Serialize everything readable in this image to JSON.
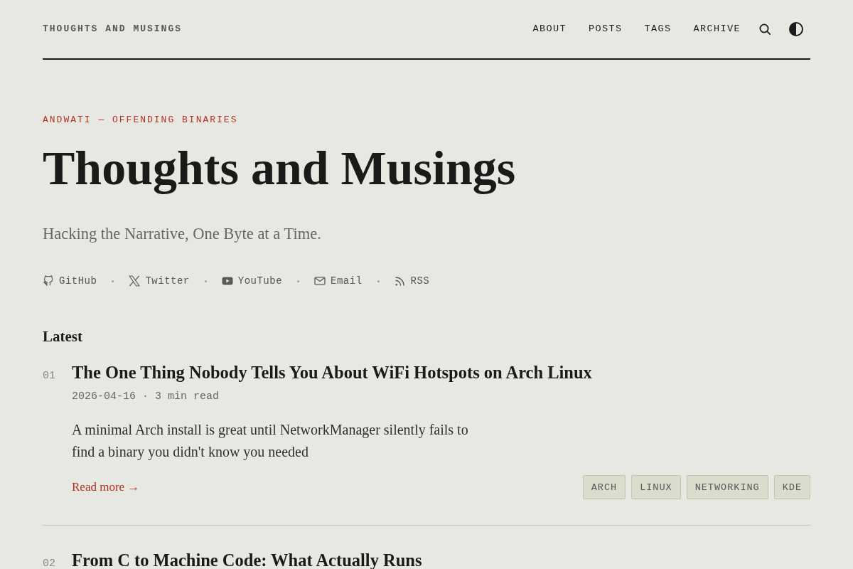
{
  "header": {
    "brand": "THOUGHTS AND MUSINGS",
    "nav": [
      {
        "label": "ABOUT"
      },
      {
        "label": "POSTS"
      },
      {
        "label": "TAGS"
      },
      {
        "label": "ARCHIVE"
      }
    ]
  },
  "hero": {
    "kicker": "ANDWATI — OFFENDING BINARIES",
    "title": "Thoughts and Musings",
    "tagline": "Hacking the Narrative, One Byte at a Time.",
    "social": [
      {
        "kind": "github",
        "label": "GitHub"
      },
      {
        "kind": "x",
        "label": "Twitter"
      },
      {
        "kind": "youtube",
        "label": "YouTube"
      },
      {
        "kind": "email",
        "label": "Email"
      },
      {
        "kind": "rss",
        "label": "RSS"
      }
    ]
  },
  "latest": {
    "heading": "Latest",
    "posts": [
      {
        "number": "01",
        "title": "The One Thing Nobody Tells You About WiFi Hotspots on Arch Linux",
        "meta": "2026-04-16 · 3 min read",
        "excerpt": "A minimal Arch install is great until NetworkManager silently fails to find a binary you didn't know you needed",
        "read_more": "Read more →",
        "tags": [
          "ARCH",
          "LINUX",
          "NETWORKING",
          "KDE"
        ]
      },
      {
        "number": "02",
        "title": "From C to Machine Code: What Actually Runs"
      }
    ]
  }
}
